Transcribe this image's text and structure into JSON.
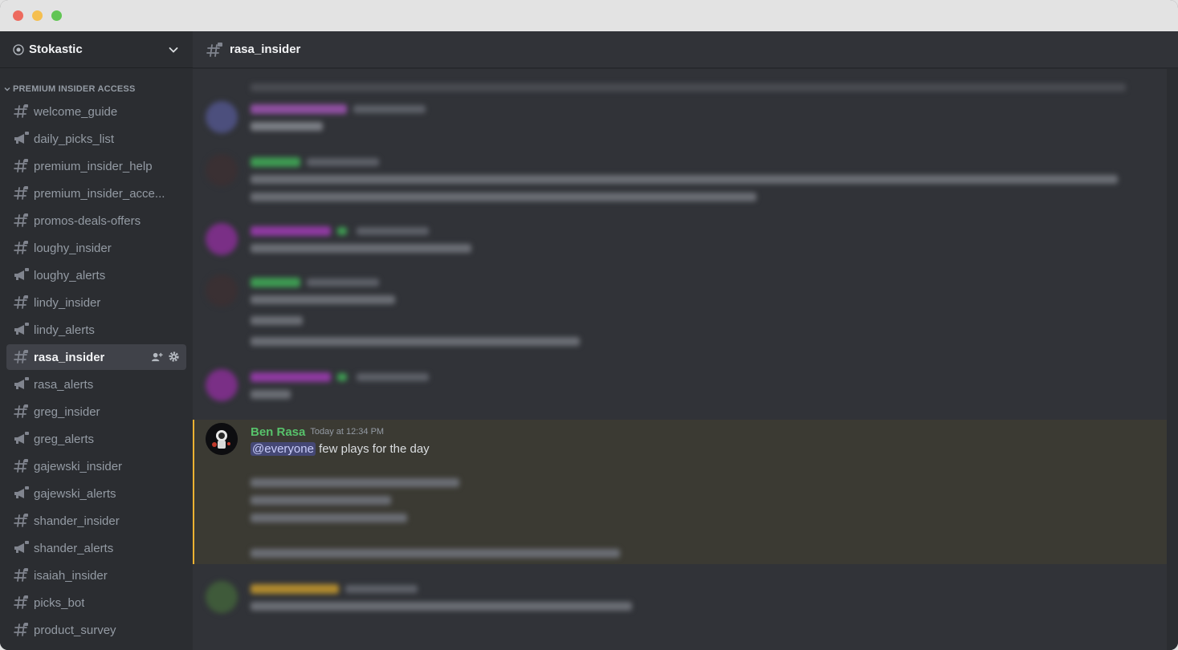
{
  "window": {
    "title": ""
  },
  "server": {
    "name": "Stokastic"
  },
  "sidebar": {
    "category": "PREMIUM INSIDER ACCESS",
    "channels": [
      {
        "name": "welcome_guide",
        "icon": "hash-icon"
      },
      {
        "name": "daily_picks_list",
        "icon": "megaphone-icon"
      },
      {
        "name": "premium_insider_help",
        "icon": "hash-icon"
      },
      {
        "name": "premium_insider_acce...",
        "icon": "hash-icon"
      },
      {
        "name": "promos-deals-offers",
        "icon": "hash-icon"
      },
      {
        "name": "loughy_insider",
        "icon": "hash-icon"
      },
      {
        "name": "loughy_alerts",
        "icon": "megaphone-icon"
      },
      {
        "name": "lindy_insider",
        "icon": "hash-icon"
      },
      {
        "name": "lindy_alerts",
        "icon": "megaphone-icon"
      },
      {
        "name": "rasa_insider",
        "icon": "hash-icon",
        "active": true
      },
      {
        "name": "rasa_alerts",
        "icon": "megaphone-icon"
      },
      {
        "name": "greg_insider",
        "icon": "hash-icon"
      },
      {
        "name": "greg_alerts",
        "icon": "megaphone-icon"
      },
      {
        "name": "gajewski_insider",
        "icon": "hash-icon"
      },
      {
        "name": "gajewski_alerts",
        "icon": "megaphone-icon"
      },
      {
        "name": "shander_insider",
        "icon": "hash-icon"
      },
      {
        "name": "shander_alerts",
        "icon": "megaphone-icon"
      },
      {
        "name": "isaiah_insider",
        "icon": "hash-icon"
      },
      {
        "name": "picks_bot",
        "icon": "hash-icon"
      },
      {
        "name": "product_survey",
        "icon": "hash-icon"
      }
    ]
  },
  "header": {
    "channel_name": "rasa_insider"
  },
  "messages": {
    "featured": {
      "author": "Ben Rasa",
      "author_color": "#57c26b",
      "timestamp": "Today at 12:34 PM",
      "mention": "@everyone",
      "text": " few plays for the day"
    }
  },
  "colors": {
    "accent": "#f0b232",
    "mention_bg": "#5865f2",
    "sidebar_bg": "#2b2d31",
    "chat_bg": "#313338"
  }
}
